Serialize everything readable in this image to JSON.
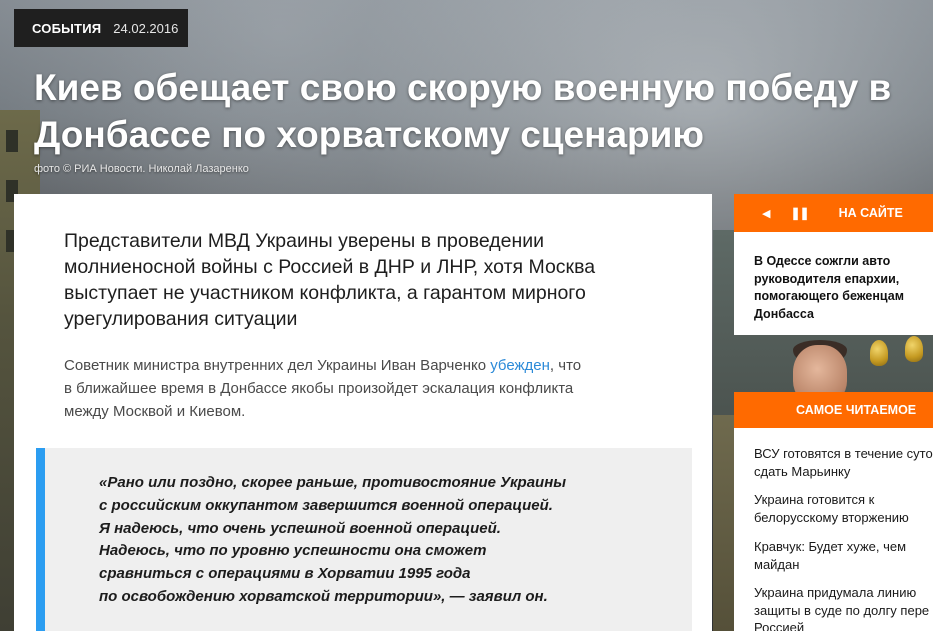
{
  "badge": {
    "category": "СОБЫТИЯ",
    "date": "24.02.2016"
  },
  "headline": {
    "line1": "Киев обещает свою скорую военную победу в",
    "line2": "Донбассе по хорватскому сценарию"
  },
  "photo_credit": "фото © РИА Новости. Николай Лазаренко",
  "lead": {
    "line1": "Представители МВД Украины уверены в проведении",
    "line2": "молниеносной войны с Россией в ДНР и ЛНР, хотя Москва",
    "line3": "выступает не участником конфликта, а гарантом мирного",
    "line4": "урегулирования ситуации"
  },
  "body": {
    "before_link": "Советник министра внутренних дел Украины Иван Варченко ",
    "link": "убежден",
    "after_link": ", что",
    "line2": "в ближайшее время в Донбассе якобы произойдет эскалация конфликта",
    "line3": "между Москвой и Киевом."
  },
  "quote": {
    "line1": "«Рано или поздно, скорее раньше, противостояние Украины",
    "line2": "с российским оккупантом завершится военной операцией.",
    "line3": "Я надеюсь, что очень успешной военной операцией.",
    "line4": "Надеюсь, что по уровню успешности она сможет",
    "line5": "сравниться с операциями в Хорватии 1995 года",
    "line6": "по освобождению хорватской территории», — заявил он."
  },
  "on_site": {
    "title": "НА САЙТЕ",
    "prev_icon": "◀",
    "pause_icon": "❚❚",
    "news": {
      "line1": "В Одессе сожгли авто",
      "line2": "руководителя епархии,",
      "line3": "помогающего беженцам",
      "line4": "Донбасса"
    }
  },
  "popular": {
    "title": "САМОЕ ЧИТАЕМОЕ",
    "items": [
      {
        "line1": "ВСУ готовятся в течение суто",
        "line2": "сдать Марьинку"
      },
      {
        "line1": "Украина готовится к",
        "line2": "белорусскому вторжению"
      },
      {
        "line1": "Кравчук: Будет хуже, чем",
        "line2": "майдан"
      },
      {
        "line1": "Украина придумала линию",
        "line2": "защиты в суде по долгу пере",
        "line3": "Россией"
      }
    ]
  },
  "colors": {
    "accent": "#ff6a00",
    "link": "#2b8ad8",
    "quote_bar": "#2b9df1"
  }
}
